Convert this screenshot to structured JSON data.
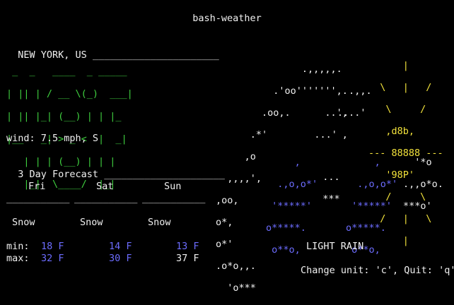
{
  "app_title": "bash-weather",
  "location": {
    "label": "NEW YORK, US",
    "underline": "______________________"
  },
  "big_temp_ascii": [
    " _  _   ____  _ _____",
    "| || | / __ \\(_)  ___|",
    "| || |_| (__) | | |_",
    "|__   _| > _ <  |  _|",
    "   | | | (__) | | |",
    "   |_|  \\____/  |_|"
  ],
  "wind": "wind: 7.5 mph, S",
  "forecast": {
    "title": "3 Day Forecast",
    "title_underline": "_____________________",
    "days": [
      {
        "name": "Fri",
        "condition": "Snow",
        "min": "18 F",
        "max": "32 F",
        "underline": "___________"
      },
      {
        "name": "Sat",
        "condition": "Snow",
        "min": "14 F",
        "max": "30 F",
        "underline": "___________"
      },
      {
        "name": "Sun",
        "condition": "Snow",
        "min": "13 F",
        "max": "37 F",
        "underline": "___________"
      }
    ],
    "min_label": "min:",
    "max_label": "max:"
  },
  "art": {
    "cloud_lines": [
      "               .,,,,,.",
      "          .'oo''''''',.",
      "        .oo,.      ..',",
      "      .*'             ,",
      "     ,o",
      "  ,,,,',",
      ",oo,",
      "o*,",
      "o*'",
      ".o*o,,.",
      "  'o***"
    ],
    "mid_lines": [
      "         .,,.",
      "       ....'",
      "   ...'",
      "",
      "",
      "",
      "",
      "",
      "",
      "  ...",
      "  ***"
    ],
    "sun_lines": [
      "      |",
      "  \\   |   /",
      "   \\     /",
      "   ,d8b,",
      "--- 88888 ---",
      "   '98P'",
      "   /     \\",
      "  /   |   \\",
      "      |"
    ],
    "rain_drops_1": [
      "     ,",
      "  .,o,o*'",
      " '*****'",
      "o*****.",
      " o**o,"
    ],
    "rain_drops_2": [
      "     ,",
      "  .,o,o*'",
      " '*****'",
      "o*****.",
      " o**o,"
    ],
    "right_cloud": [
      "  '*o",
      ".,,o*o.",
      "***o'"
    ]
  },
  "condition": "LIGHT RAIN",
  "help": "Change unit: 'c', Quit: 'q'"
}
